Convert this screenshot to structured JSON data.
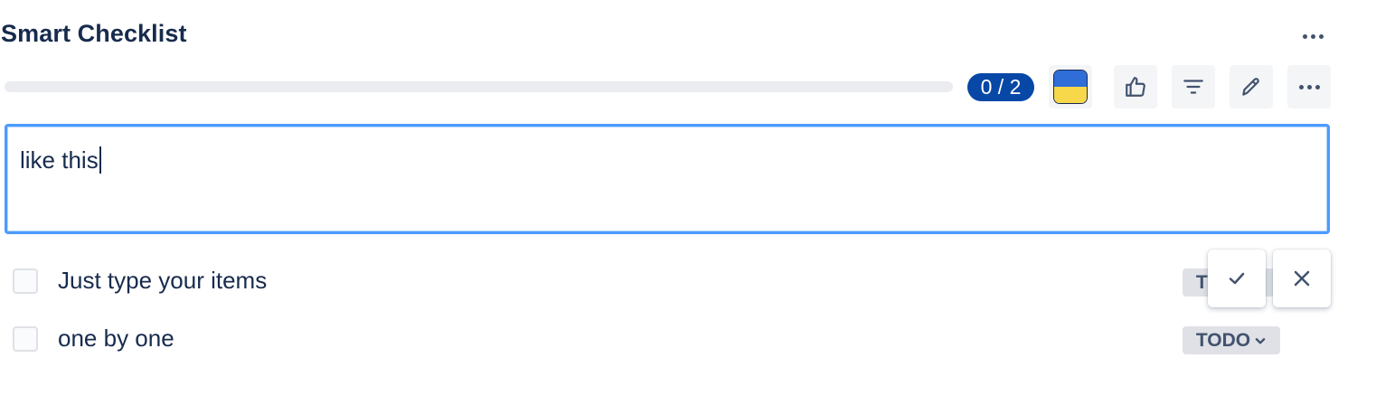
{
  "header": {
    "title": "Smart Checklist",
    "more_icon": "more-horizontal-icon"
  },
  "progress": {
    "completed": 0,
    "total": 2,
    "fraction": 0,
    "label": "0 / 2"
  },
  "toolbar": {
    "buttons": [
      {
        "name": "flag-icon",
        "colors": [
          "#2f6dd8",
          "#f7d84a"
        ]
      },
      {
        "name": "thumbs-up-icon"
      },
      {
        "name": "filter-icon"
      },
      {
        "name": "edit-pencil-icon"
      },
      {
        "name": "more-horizontal-icon"
      }
    ]
  },
  "editor": {
    "value": "like this"
  },
  "items": [
    {
      "text": "Just type your items",
      "status": "TODO",
      "checked": false
    },
    {
      "text": "one by one",
      "status": "TODO",
      "checked": false
    }
  ],
  "actions": {
    "confirm_icon": "check-icon",
    "cancel_icon": "close-icon"
  },
  "colors": {
    "accent": "#0747a6",
    "focus": "#4c9aff",
    "text": "#172b4d"
  }
}
